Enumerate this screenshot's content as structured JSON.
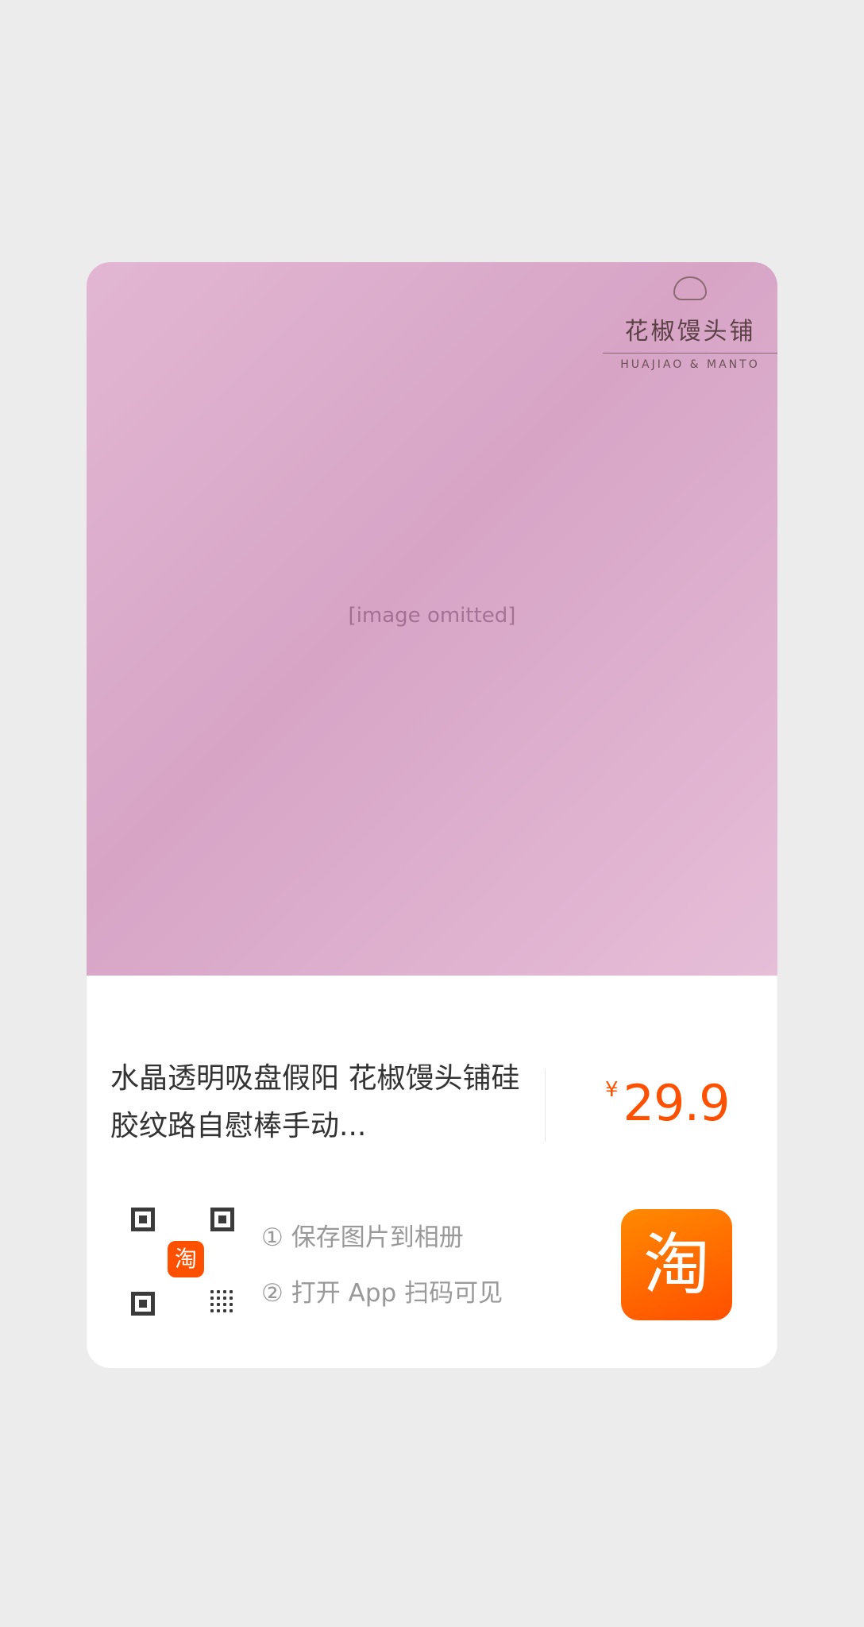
{
  "product": {
    "title": "水晶透明吸盘假阳 花椒馒头铺硅胶纹路自慰棒手动...",
    "price_symbol": "¥",
    "price": "29.9",
    "price_color": "#ff5000"
  },
  "watermark": {
    "shop_name": "花椒馒头铺",
    "shop_name_en": "HUAJIAO & MANTO"
  },
  "share": {
    "qr_badge": "淘",
    "steps": [
      {
        "num": "①",
        "text": "保存图片到相册"
      },
      {
        "num": "②",
        "text": "打开 App 扫码可见"
      }
    ]
  },
  "app_logo": {
    "glyph": "淘",
    "color": "#ff5000",
    "icon": "taobao-app-icon"
  }
}
